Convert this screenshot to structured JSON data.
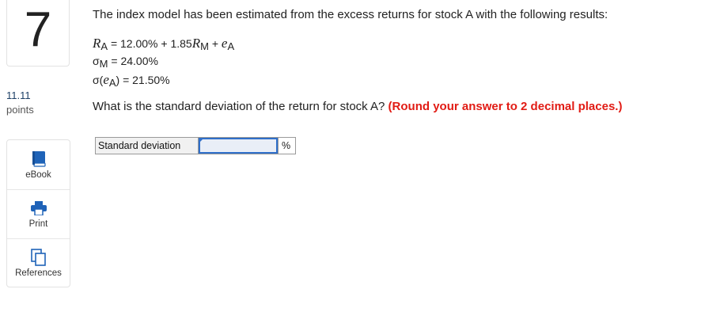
{
  "question": {
    "number": "7",
    "points_value": "11.11",
    "points_label": "points",
    "stem": "The index model has been estimated from the excess returns for stock A with the following results:",
    "formulas": {
      "line1": {
        "r": "R",
        "r_sub": "A",
        "eq_part": " = 12.00% + 1.85",
        "rm": "R",
        "rm_sub": "M",
        "plus": " + ",
        "e": "e",
        "e_sub": "A"
      },
      "line2": {
        "sigma": "σ",
        "sigma_sub": "M",
        "value": " = 24.00%"
      },
      "line3": {
        "prefix": "σ(",
        "e": "e",
        "e_sub": "A",
        "suffix": ") = 21.50%"
      }
    },
    "ask": "What is the standard deviation of the return for stock A?",
    "hint": "(Round your answer to 2 decimal places.)"
  },
  "answer_row": {
    "label": "Standard deviation",
    "input_value": "",
    "unit": "%"
  },
  "tools": [
    {
      "label": "eBook",
      "icon": "book-icon"
    },
    {
      "label": "Print",
      "icon": "printer-icon"
    },
    {
      "label": "References",
      "icon": "copy-pages-icon"
    }
  ],
  "colors": {
    "accent_blue": "#2f6fca",
    "hint_red": "#e11b14",
    "points_blue": "#1d3f66"
  }
}
